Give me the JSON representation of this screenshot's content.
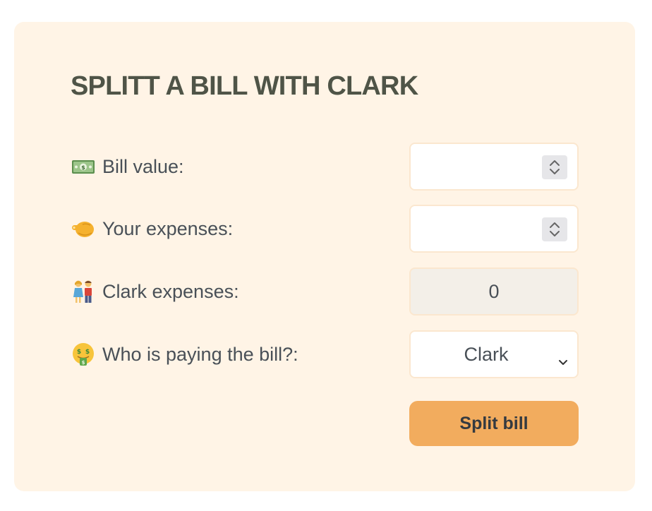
{
  "form": {
    "title": "Splitt a bill with Clark",
    "bill_value": {
      "label": "Bill value:",
      "icon": "money-bill-icon",
      "value": ""
    },
    "your_expenses": {
      "label": "Your expenses:",
      "icon": "pointing-finger-icon",
      "value": ""
    },
    "friend_expenses": {
      "label": "Clark expenses:",
      "icon": "couple-icon",
      "value": "0"
    },
    "who_pays": {
      "label": "Who is paying the bill?:",
      "icon": "money-mouth-face-icon",
      "selected": "Clark"
    },
    "submit_label": "Split bill"
  },
  "colors": {
    "card_bg": "#fff4e6",
    "button_bg": "#f2ac5e",
    "text": "#495057",
    "title": "#4f5447"
  }
}
